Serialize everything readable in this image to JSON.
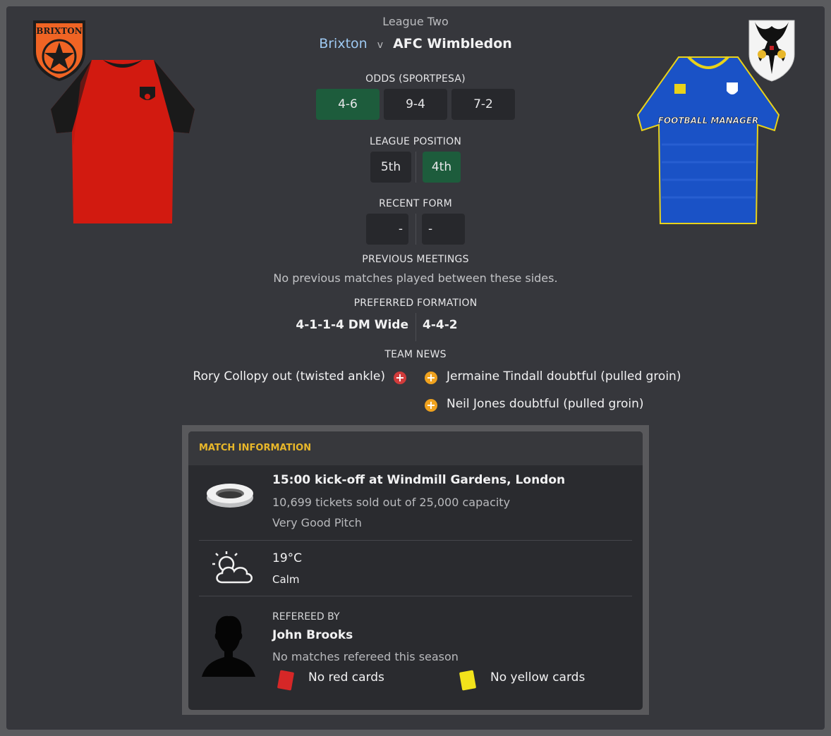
{
  "competition": "League Two",
  "home_team": "Brixton",
  "vs": "v",
  "away_team": "AFC Wimbledon",
  "home_badge_text": "BRIXTON",
  "away_kit_sponsor": "FOOTBALL MANAGER",
  "odds": {
    "label": "ODDS (SPORTPESA)",
    "home": "4-6",
    "draw": "9-4",
    "away": "7-2"
  },
  "league_position": {
    "label": "LEAGUE POSITION",
    "home": "5th",
    "away": "4th"
  },
  "recent_form": {
    "label": "RECENT FORM",
    "home": "-",
    "away": "-"
  },
  "previous_meetings": {
    "label": "PREVIOUS MEETINGS",
    "text": "No previous matches played between these sides."
  },
  "preferred_formation": {
    "label": "PREFERRED FORMATION",
    "home": "4-1-1-4 DM Wide",
    "away": "4-4-2"
  },
  "team_news": {
    "label": "TEAM NEWS",
    "home": [
      {
        "text": "Rory Collopy out (twisted ankle)",
        "status": "out",
        "icon": "injury-out-icon"
      }
    ],
    "away": [
      {
        "text": "Jermaine Tindall doubtful (pulled groin)",
        "status": "doubtful",
        "icon": "injury-doubtful-icon"
      },
      {
        "text": "Neil Jones doubtful (pulled groin)",
        "status": "doubtful",
        "icon": "injury-doubtful-icon"
      }
    ]
  },
  "match_info": {
    "title": "MATCH INFORMATION",
    "venue": {
      "headline": "15:00 kick-off at Windmill Gardens, London",
      "tickets": "10,699 tickets sold out of 25,000 capacity",
      "pitch": "Very Good Pitch",
      "icon": "stadium-icon"
    },
    "weather": {
      "temp": "19°C",
      "wind": "Calm",
      "icon": "partly-cloudy-icon"
    },
    "referee": {
      "label": "REFEREED BY",
      "name": "John Brooks",
      "note": "No matches refereed this season",
      "red_cards": "No red cards",
      "yellow_cards": "No yellow cards",
      "icon": "referee-silhouette-icon"
    }
  },
  "colors": {
    "panel": "#36373c",
    "green_highlight": "#1d5c3c",
    "home_link": "#9ec9f2",
    "accent_yellow": "#e8b72a",
    "red_icon": "#d13b3b",
    "orange_icon": "#f0a21e"
  }
}
